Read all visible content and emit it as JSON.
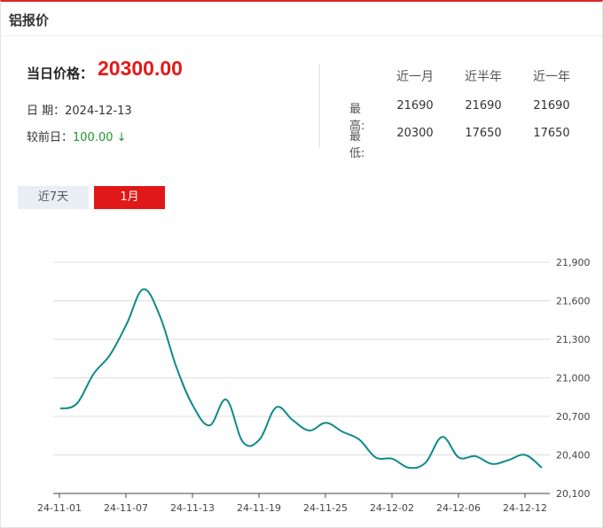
{
  "header": {
    "title": "铝报价"
  },
  "summary": {
    "price_label": "当日价格：",
    "price_value": "20300.00",
    "date_label": "日 期：",
    "date_value": "2024-12-13",
    "change_label": "较前日：",
    "change_value": "100.00",
    "change_arrow": "↓"
  },
  "stats": {
    "headers": [
      "近一月",
      "近半年",
      "近一年"
    ],
    "rows": [
      {
        "label": "最高:",
        "values": [
          "21690",
          "21690",
          "21690"
        ]
      },
      {
        "label": "最低:",
        "values": [
          "20300",
          "17650",
          "17650"
        ]
      }
    ]
  },
  "tabs": [
    {
      "label": "近7天",
      "active": false
    },
    {
      "label": "1月",
      "active": true
    }
  ],
  "colors": {
    "line": "#0f8a8a",
    "accent": "#e01818",
    "down": "#1a9a2a"
  },
  "chart_data": {
    "type": "line",
    "x_tick_labels": [
      "24-11-01",
      "24-11-07",
      "24-11-13",
      "24-11-19",
      "24-11-25",
      "24-12-02",
      "24-12-06",
      "24-12-12"
    ],
    "y_tick_labels": [
      "21,900",
      "21,600",
      "21,300",
      "21,000",
      "20,700",
      "20,400",
      "20,100"
    ],
    "ylim": [
      20100,
      21900
    ],
    "grid": true,
    "x": [
      "24-11-01",
      "24-11-02",
      "24-11-03",
      "24-11-04",
      "24-11-05",
      "24-11-06",
      "24-11-07",
      "24-11-08",
      "24-11-09",
      "24-11-10",
      "24-11-11",
      "24-11-12",
      "24-11-13",
      "24-11-14",
      "24-11-15",
      "24-11-16",
      "24-11-17",
      "24-11-18",
      "24-11-19",
      "24-11-20",
      "24-11-21",
      "24-11-22",
      "24-11-23",
      "24-11-24",
      "24-11-25",
      "24-11-26",
      "24-11-27",
      "24-11-28",
      "24-11-29",
      "24-11-30",
      "24-12-01",
      "24-12-02",
      "24-12-03",
      "24-12-04",
      "24-12-05",
      "24-12-06",
      "24-12-07",
      "24-12-08",
      "24-12-09",
      "24-12-10",
      "24-12-11",
      "24-12-12",
      "24-12-13"
    ],
    "values": [
      20760,
      20800,
      21030,
      21180,
      21420,
      21690,
      21480,
      21080,
      20780,
      20630,
      20830,
      20500,
      20520,
      20770,
      20670,
      20590,
      20650,
      20580,
      20520,
      20380,
      20370,
      20300,
      20340,
      20540,
      20380,
      20390,
      20330,
      20360,
      20400,
      20300
    ]
  }
}
